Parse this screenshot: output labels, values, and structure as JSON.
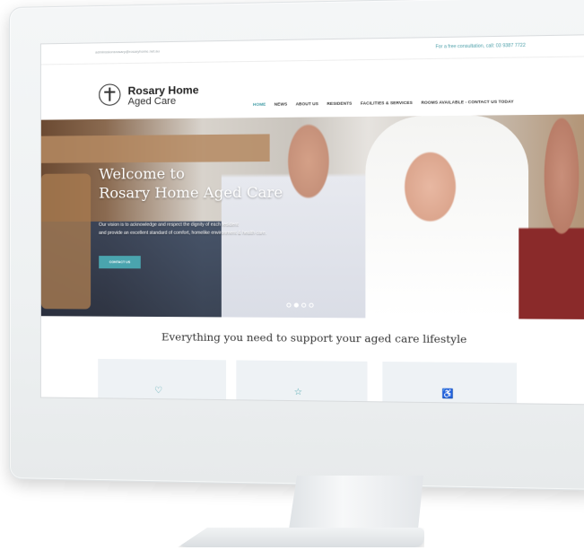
{
  "topbar": {
    "email": "adminssionsrosary@rosaryhome.net.au",
    "phone": "For a free consultation, call: 03 9387 7722"
  },
  "header": {
    "logo_line1": "Rosary Home",
    "logo_line2": "Aged Care"
  },
  "nav": {
    "items": [
      {
        "label": "HOME"
      },
      {
        "label": "NEWS"
      },
      {
        "label": "ABOUT US"
      },
      {
        "label": "RESIDENTS"
      },
      {
        "label": "FACILITIES & SERVICES"
      },
      {
        "label": "ROOMS AVAILABLE - CONTACT US TODAY"
      }
    ]
  },
  "hero": {
    "title_line1": "Welcome to",
    "title_line2": "Rosary Home Aged Care",
    "text_line1": "Our vision is to acknowledge and respect the dignity of each resident",
    "text_line2": "and provide an excellent standard of comfort, homelike environment & health care.",
    "button": "CONTACT US",
    "active_slide": 2,
    "slide_count": 4
  },
  "section": {
    "title": "Everything you need to support your aged care lifestyle"
  },
  "cards": [
    {
      "icon": "heart-icon",
      "glyph": "♡"
    },
    {
      "icon": "star-icon",
      "glyph": "☆"
    },
    {
      "icon": "wheelchair-icon",
      "glyph": "♿"
    }
  ],
  "colors": {
    "accent": "#4aa4ae",
    "nav_active": "#3e9aa4"
  }
}
